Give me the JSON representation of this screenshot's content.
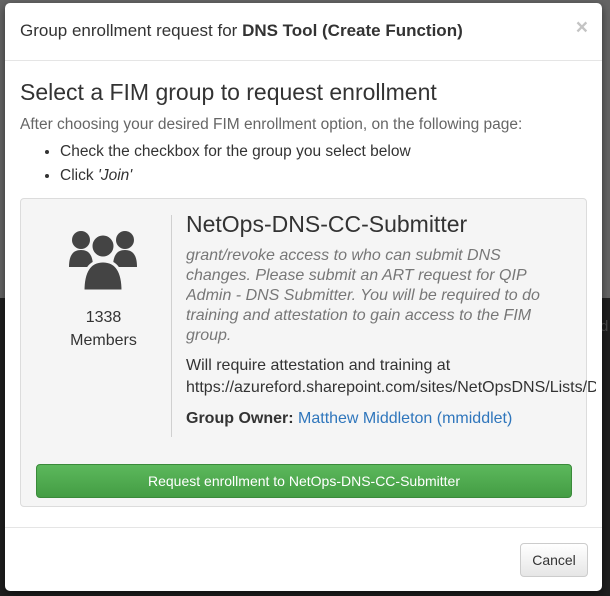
{
  "modal": {
    "title_prefix": "Group enrollment request for ",
    "title_bold": "DNS Tool (Create Function)",
    "close_label": "×",
    "heading": "Select a FIM group to request enrollment",
    "intro": "After choosing your desired FIM enrollment option, on the following page:",
    "steps": {
      "step1": "Check the checkbox for the group you select below",
      "step2_prefix": "Click ",
      "step2_em": "'Join'"
    },
    "group": {
      "icon": "users-icon",
      "member_count": "1338",
      "member_label": "Members",
      "name": "NetOps-DNS-CC-Submitter",
      "description": "grant/revoke access to who can submit DNS changes. Please submit an ART request for QIP Admin - DNS Submitter. You will be required to do training and attestation to gain access to the FIM group.",
      "attestation_line1": "Will require attestation and training at",
      "attestation_line2": "https://azureford.sharepoint.com/sites/NetOpsDNS/Lists/D",
      "owner_label": "Group Owner:",
      "owner_name": "Matthew Middleton (mmiddlet)",
      "request_button": "Request enrollment to NetOps-DNS-CC-Submitter"
    },
    "cancel_button": "Cancel"
  },
  "colors": {
    "primary_button": "#5cb85c",
    "link": "#2f76bc",
    "muted_text": "#777777"
  }
}
